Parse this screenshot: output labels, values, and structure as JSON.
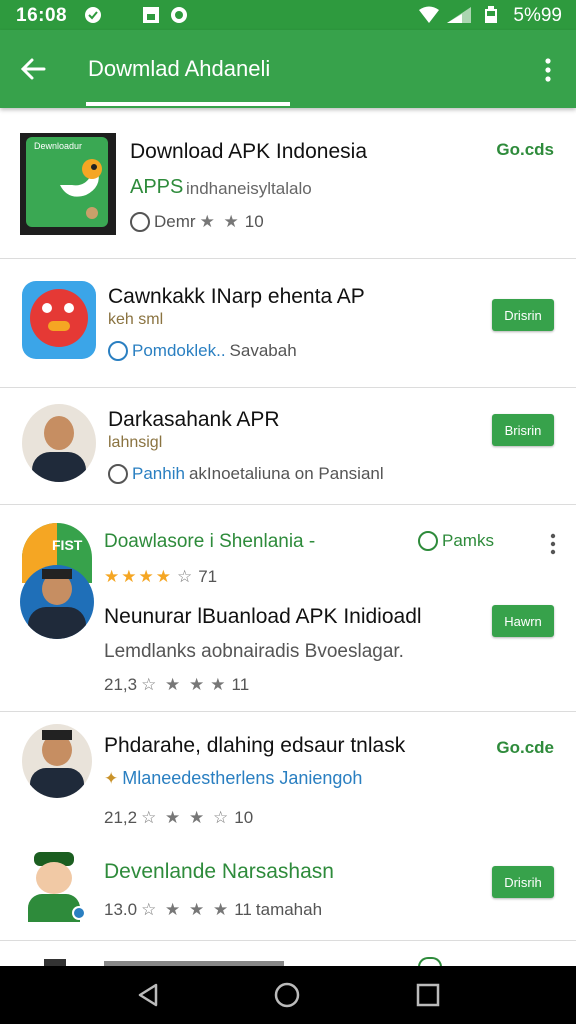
{
  "status_bar": {
    "time": "16:08",
    "battery": "5%99"
  },
  "app_bar": {
    "title": "Dowmlad Ahdaneli"
  },
  "items": [
    {
      "name": "Download APK Indonesia",
      "sub": "APPS indhaneisyltalalo",
      "sub_lead": "APPS",
      "meta_text": "Demr",
      "rating": "10",
      "price": "Go.cds"
    },
    {
      "name": "Cawnkakk INarp ehenta AP",
      "sub": "keh sml",
      "meta_link": "Pomdoklek..",
      "meta_text": "Savabah",
      "button": "Drisrin"
    },
    {
      "name": "Darkasahank APR",
      "sub": "lahnsigl",
      "meta_link": "Panhih",
      "meta_text": "akInoetaliuna on Pansianl",
      "button": "Brisrin"
    },
    {
      "name": "Doawlasore i Shenlania  -",
      "badge": "Pamks",
      "rating": "71",
      "name2": "Neunurar lBuanload APK Inidioadl",
      "sub2": "Lemdlanks aobnairadis Bvoeslagar.",
      "count": "21,3",
      "rating2": "11",
      "button": "Hawrn",
      "thumb_label": "FIST"
    },
    {
      "name": "Phdarahe, dlahing edsaur tnlask",
      "sub": "Mlaneedestherlens Janiengoh",
      "count": "21,2",
      "rating": "10",
      "price": "Go.cde"
    },
    {
      "name": "Devenlande Narsashasn",
      "count": "13.0",
      "rating": "11",
      "meta_text": "tamahah",
      "button": "Drisrih"
    }
  ],
  "thumb1_label": "Dewnloadur",
  "colors": {
    "primary": "#37a24b",
    "status": "#2e9a3e",
    "accent": "#f5a623"
  }
}
